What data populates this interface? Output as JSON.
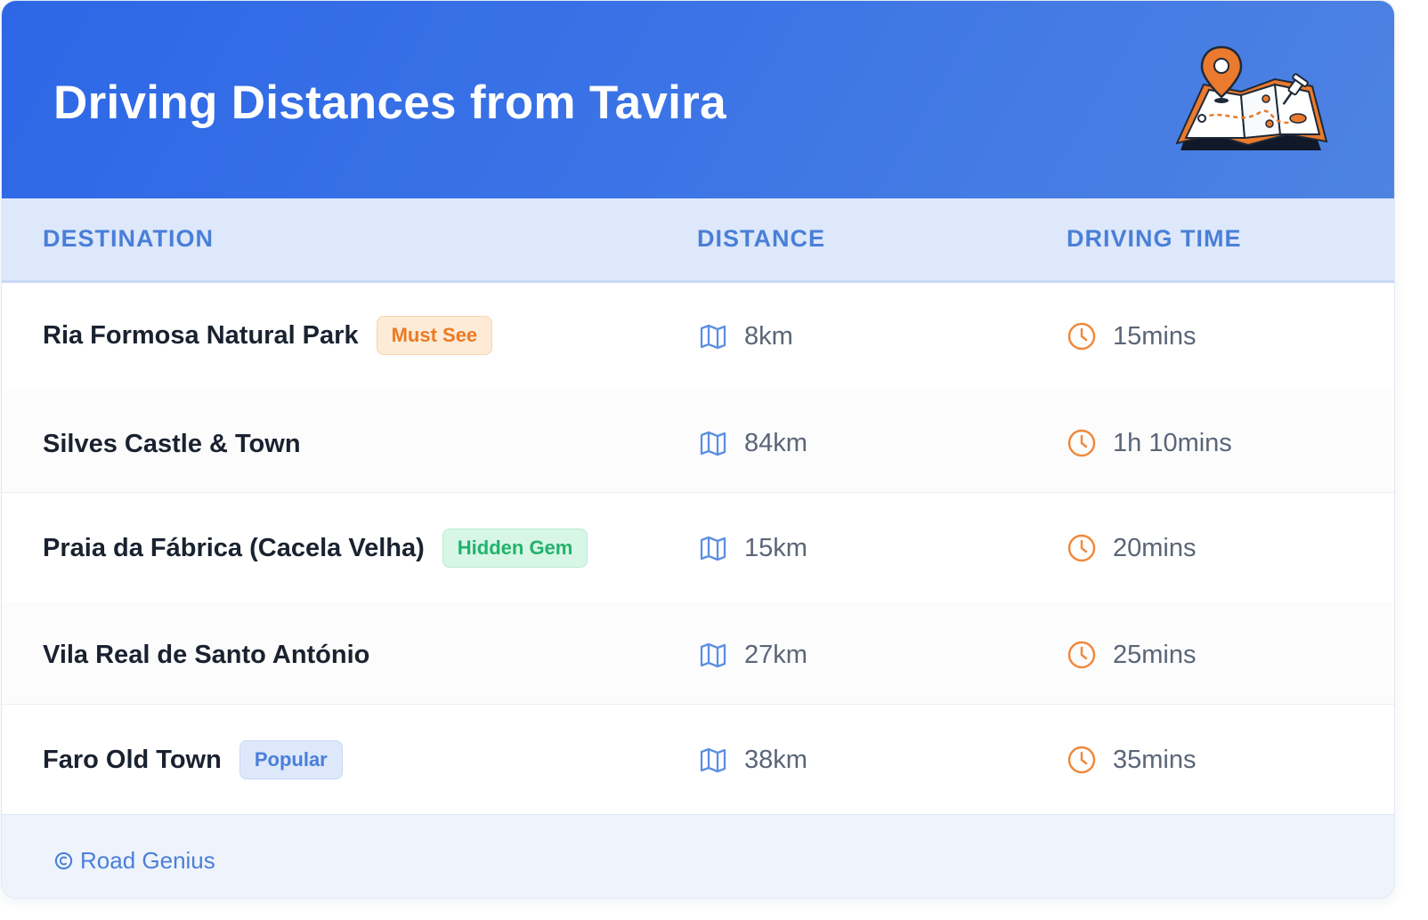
{
  "header": {
    "title": "Driving Distances from Tavira",
    "illustration": "map-with-pin-illustration"
  },
  "table": {
    "columns": [
      "DESTINATION",
      "DISTANCE",
      "DRIVING TIME"
    ],
    "rows": [
      {
        "destination": "Ria Formosa Natural Park",
        "badge": "Must See",
        "badge_color": "#ec7a24",
        "distance": "8km",
        "time": "15mins"
      },
      {
        "destination": "Silves Castle & Town",
        "badge": "",
        "distance": "84km",
        "time": "1h 10mins"
      },
      {
        "destination": "Praia da Fábrica (Cacela Velha)",
        "badge": "Hidden Gem",
        "badge_color": "#22b36c",
        "distance": "15km",
        "time": "20mins"
      },
      {
        "destination": "Vila Real de Santo António",
        "badge": "",
        "distance": "27km",
        "time": "25mins"
      },
      {
        "destination": "Faro Old Town",
        "badge": "Popular",
        "badge_color": "#4a7fd8",
        "distance": "38km",
        "time": "35mins"
      }
    ],
    "icons": {
      "distance": "map-icon",
      "time": "clock-icon"
    }
  },
  "footer": {
    "text": "Road Genius",
    "icon": "copyright-icon"
  },
  "colors": {
    "header_gradient_start": "#2d67e6",
    "header_gradient_end": "#4e83e2",
    "accent_blue": "#4a7fd8",
    "icon_orange": "#f0893c"
  }
}
